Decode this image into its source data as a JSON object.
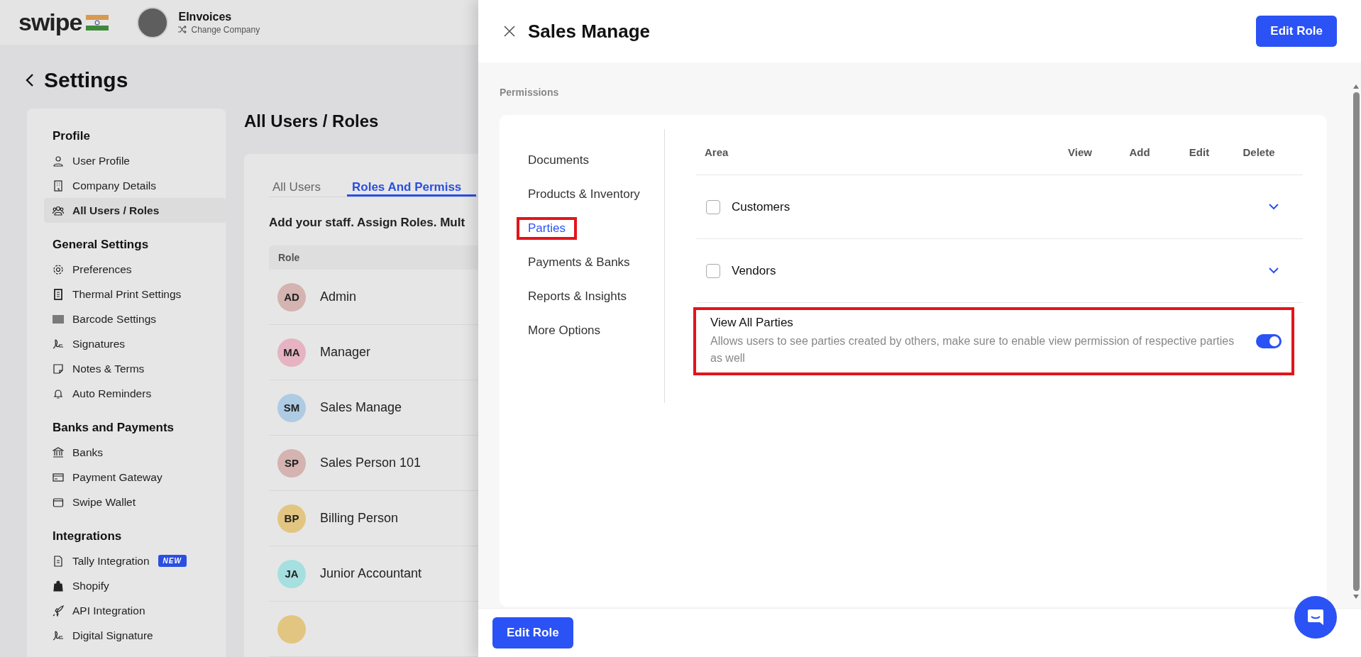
{
  "topbar": {
    "logo": "swipe",
    "company": "EInvoices",
    "switch_label": "Change Company"
  },
  "page_title": "Settings",
  "sidebar": {
    "groups": [
      {
        "title": "Profile",
        "items": [
          {
            "label": "User Profile",
            "selected": false
          },
          {
            "label": "Company Details",
            "selected": false
          },
          {
            "label": "All Users / Roles",
            "selected": true
          }
        ]
      },
      {
        "title": "General Settings",
        "items": [
          {
            "label": "Preferences",
            "selected": false
          },
          {
            "label": "Thermal Print Settings",
            "selected": false
          },
          {
            "label": "Barcode Settings",
            "selected": false
          },
          {
            "label": "Signatures",
            "selected": false
          },
          {
            "label": "Notes & Terms",
            "selected": false
          },
          {
            "label": "Auto Reminders",
            "selected": false
          }
        ]
      },
      {
        "title": "Banks and Payments",
        "items": [
          {
            "label": "Banks",
            "selected": false
          },
          {
            "label": "Payment Gateway",
            "selected": false
          },
          {
            "label": "Swipe Wallet",
            "selected": false
          }
        ]
      },
      {
        "title": "Integrations",
        "items": [
          {
            "label": "Tally Integration",
            "selected": false,
            "badge": "NEW"
          },
          {
            "label": "Shopify",
            "selected": false
          },
          {
            "label": "API Integration",
            "selected": false
          },
          {
            "label": "Digital Signature",
            "selected": false
          }
        ]
      }
    ]
  },
  "main": {
    "title": "All Users / Roles",
    "tabs": [
      {
        "label": "All Users",
        "selected": false
      },
      {
        "label": "Roles And Permiss",
        "selected": true
      }
    ],
    "intro": "Add your staff. Assign Roles. Mult",
    "column": "Role",
    "roles": [
      {
        "initials": "AD",
        "name": "Admin",
        "color": "#d4b3b0"
      },
      {
        "initials": "MA",
        "name": "Manager",
        "color": "#e6b3c3"
      },
      {
        "initials": "SM",
        "name": "Sales Manage",
        "color": "#aecbe4"
      },
      {
        "initials": "SP",
        "name": "Sales Person 101",
        "color": "#d4b3b0"
      },
      {
        "initials": "BP",
        "name": "Billing Person",
        "color": "#e2c580"
      },
      {
        "initials": "JA",
        "name": "Junior Accountant",
        "color": "#a6dfdf"
      },
      {
        "color": "#e2c580"
      }
    ]
  },
  "drawer": {
    "title": "Sales Manage",
    "edit_button": "Edit Role",
    "footer_button": "Edit Role",
    "permissions": {
      "label": "Permissions",
      "nav": [
        {
          "label": "Documents",
          "selected": false,
          "annotated": false
        },
        {
          "label": "Products & Inventory",
          "selected": false,
          "annotated": false
        },
        {
          "label": "Parties",
          "selected": true,
          "annotated": true
        },
        {
          "label": "Payments & Banks",
          "selected": false,
          "annotated": false
        },
        {
          "label": "Reports & Insights",
          "selected": false,
          "annotated": false
        },
        {
          "label": "More Options",
          "selected": false,
          "annotated": false
        }
      ],
      "columns": [
        "Area",
        "View",
        "Add",
        "Edit",
        "Delete"
      ],
      "rows": [
        {
          "name": "Customers",
          "checked": false,
          "expanded": false
        },
        {
          "name": "Vendors",
          "checked": false,
          "expanded": false
        }
      ],
      "setting": {
        "title": "View All Parties",
        "description": "Allows users to see parties created by others, make sure to enable view permission of respective parties as well",
        "on": true,
        "annotated": true
      }
    }
  }
}
